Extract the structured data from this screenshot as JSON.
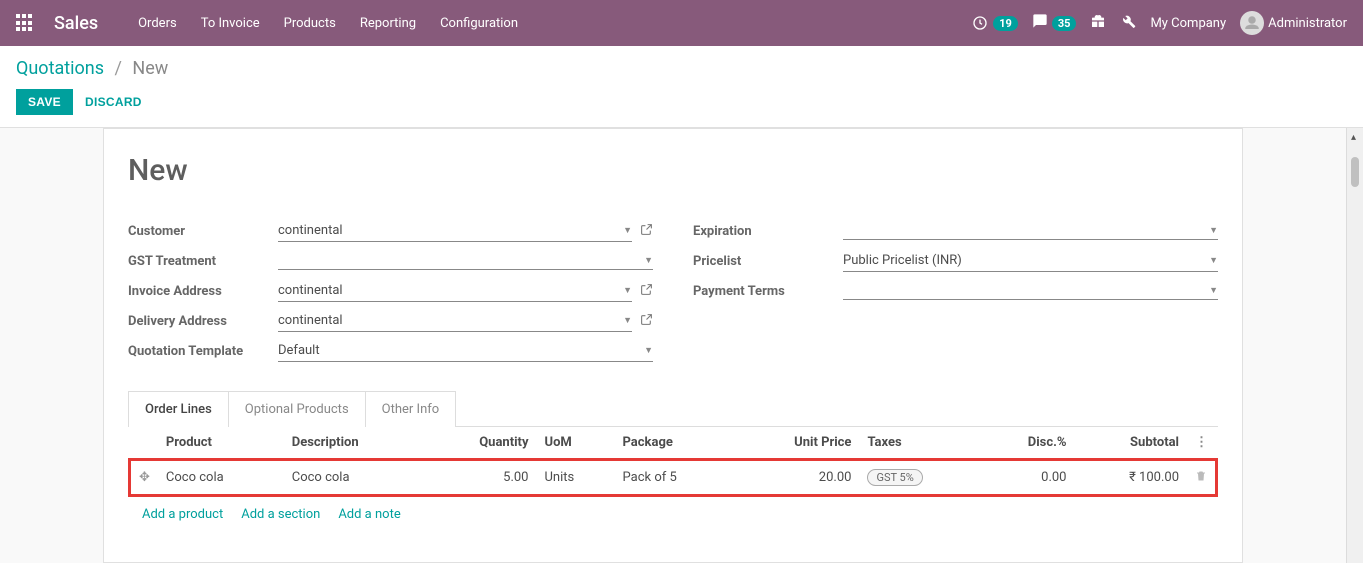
{
  "topbar": {
    "brand": "Sales",
    "menu": [
      "Orders",
      "To Invoice",
      "Products",
      "Reporting",
      "Configuration"
    ],
    "badge1": "19",
    "badge2": "35",
    "company": "My Company",
    "user": "Administrator"
  },
  "breadcrumb": {
    "root": "Quotations",
    "current": "New"
  },
  "actions": {
    "save": "SAVE",
    "discard": "DISCARD"
  },
  "form": {
    "title": "New",
    "labels": {
      "customer": "Customer",
      "gst_treatment": "GST Treatment",
      "invoice_address": "Invoice Address",
      "delivery_address": "Delivery Address",
      "quotation_template": "Quotation Template",
      "expiration": "Expiration",
      "pricelist": "Pricelist",
      "payment_terms": "Payment Terms"
    },
    "values": {
      "customer": "continental",
      "gst_treatment": "",
      "invoice_address": "continental",
      "delivery_address": "continental",
      "quotation_template": "Default",
      "expiration": "",
      "pricelist": "Public Pricelist (INR)",
      "payment_terms": ""
    }
  },
  "tabs": {
    "order_lines": "Order Lines",
    "optional_products": "Optional Products",
    "other_info": "Other Info"
  },
  "table": {
    "headers": {
      "product": "Product",
      "description": "Description",
      "quantity": "Quantity",
      "uom": "UoM",
      "package": "Package",
      "unit_price": "Unit Price",
      "taxes": "Taxes",
      "disc": "Disc.%",
      "subtotal": "Subtotal"
    },
    "row": {
      "product": "Coco cola",
      "description": "Coco cola",
      "quantity": "5.00",
      "uom": "Units",
      "package": "Pack of 5",
      "unit_price": "20.00",
      "taxes": "GST 5%",
      "disc": "0.00",
      "subtotal": "₹ 100.00"
    },
    "footer_links": {
      "add_product": "Add a product",
      "add_section": "Add a section",
      "add_note": "Add a note"
    }
  }
}
